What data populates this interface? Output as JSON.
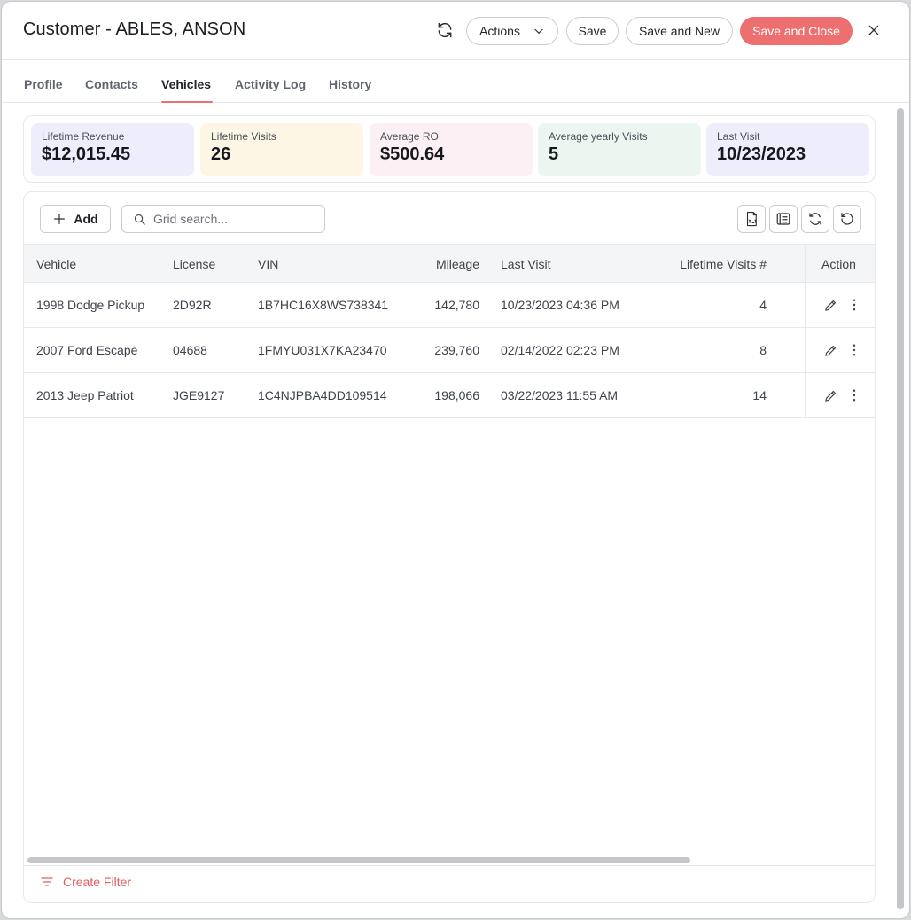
{
  "header": {
    "title": "Customer - ABLES, ANSON",
    "actions_label": "Actions",
    "save_label": "Save",
    "save_new_label": "Save and New",
    "save_close_label": "Save and Close"
  },
  "tabs": [
    {
      "label": "Profile"
    },
    {
      "label": "Contacts"
    },
    {
      "label": "Vehicles",
      "active": true
    },
    {
      "label": "Activity Log"
    },
    {
      "label": "History"
    }
  ],
  "stats": [
    {
      "label": "Lifetime Revenue",
      "value": "$12,015.45",
      "color": "#ededfb"
    },
    {
      "label": "Lifetime Visits",
      "value": "26",
      "color": "#fdf6e4"
    },
    {
      "label": "Average RO",
      "value": "$500.64",
      "color": "#fdf0f4"
    },
    {
      "label": "Average yearly Visits",
      "value": "5",
      "color": "#eaf6ef"
    },
    {
      "label": "Last Visit",
      "value": "10/23/2023",
      "color": "#ededfb"
    }
  ],
  "toolbar": {
    "add_label": "Add",
    "search_placeholder": "Grid search..."
  },
  "table": {
    "columns": [
      "Vehicle",
      "License",
      "VIN",
      "Mileage",
      "Last Visit",
      "Lifetime Visits #",
      "Action"
    ],
    "rows": [
      {
        "vehicle": "1998 Dodge Pickup",
        "license": "2D92R",
        "vin": "1B7HC16X8WS738341",
        "mileage": "142,780",
        "last_visit": "10/23/2023 04:36 PM",
        "visits": "4"
      },
      {
        "vehicle": "2007 Ford Escape",
        "license": "04688",
        "vin": "1FMYU031X7KA23470",
        "mileage": "239,760",
        "last_visit": "02/14/2022 02:23 PM",
        "visits": "8"
      },
      {
        "vehicle": "2013 Jeep Patriot",
        "license": "JGE9127",
        "vin": "1C4NJPBA4DD109514",
        "mileage": "198,066",
        "last_visit": "03/22/2023 11:55 AM",
        "visits": "14"
      }
    ]
  },
  "footer": {
    "create_filter_label": "Create Filter"
  },
  "colors": {
    "accent": "#ee6f6f"
  }
}
